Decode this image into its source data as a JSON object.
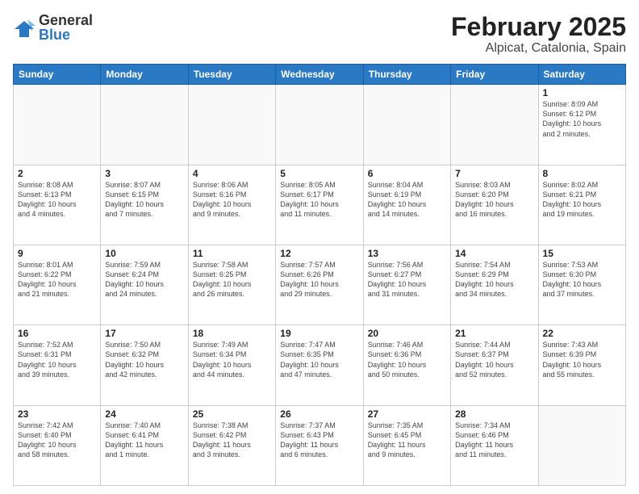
{
  "header": {
    "logo_general": "General",
    "logo_blue": "Blue",
    "title": "February 2025",
    "subtitle": "Alpicat, Catalonia, Spain"
  },
  "weekdays": [
    "Sunday",
    "Monday",
    "Tuesday",
    "Wednesday",
    "Thursday",
    "Friday",
    "Saturday"
  ],
  "weeks": [
    [
      {
        "day": "",
        "info": ""
      },
      {
        "day": "",
        "info": ""
      },
      {
        "day": "",
        "info": ""
      },
      {
        "day": "",
        "info": ""
      },
      {
        "day": "",
        "info": ""
      },
      {
        "day": "",
        "info": ""
      },
      {
        "day": "1",
        "info": "Sunrise: 8:09 AM\nSunset: 6:12 PM\nDaylight: 10 hours\nand 2 minutes."
      }
    ],
    [
      {
        "day": "2",
        "info": "Sunrise: 8:08 AM\nSunset: 6:13 PM\nDaylight: 10 hours\nand 4 minutes."
      },
      {
        "day": "3",
        "info": "Sunrise: 8:07 AM\nSunset: 6:15 PM\nDaylight: 10 hours\nand 7 minutes."
      },
      {
        "day": "4",
        "info": "Sunrise: 8:06 AM\nSunset: 6:16 PM\nDaylight: 10 hours\nand 9 minutes."
      },
      {
        "day": "5",
        "info": "Sunrise: 8:05 AM\nSunset: 6:17 PM\nDaylight: 10 hours\nand 11 minutes."
      },
      {
        "day": "6",
        "info": "Sunrise: 8:04 AM\nSunset: 6:19 PM\nDaylight: 10 hours\nand 14 minutes."
      },
      {
        "day": "7",
        "info": "Sunrise: 8:03 AM\nSunset: 6:20 PM\nDaylight: 10 hours\nand 16 minutes."
      },
      {
        "day": "8",
        "info": "Sunrise: 8:02 AM\nSunset: 6:21 PM\nDaylight: 10 hours\nand 19 minutes."
      }
    ],
    [
      {
        "day": "9",
        "info": "Sunrise: 8:01 AM\nSunset: 6:22 PM\nDaylight: 10 hours\nand 21 minutes."
      },
      {
        "day": "10",
        "info": "Sunrise: 7:59 AM\nSunset: 6:24 PM\nDaylight: 10 hours\nand 24 minutes."
      },
      {
        "day": "11",
        "info": "Sunrise: 7:58 AM\nSunset: 6:25 PM\nDaylight: 10 hours\nand 26 minutes."
      },
      {
        "day": "12",
        "info": "Sunrise: 7:57 AM\nSunset: 6:26 PM\nDaylight: 10 hours\nand 29 minutes."
      },
      {
        "day": "13",
        "info": "Sunrise: 7:56 AM\nSunset: 6:27 PM\nDaylight: 10 hours\nand 31 minutes."
      },
      {
        "day": "14",
        "info": "Sunrise: 7:54 AM\nSunset: 6:29 PM\nDaylight: 10 hours\nand 34 minutes."
      },
      {
        "day": "15",
        "info": "Sunrise: 7:53 AM\nSunset: 6:30 PM\nDaylight: 10 hours\nand 37 minutes."
      }
    ],
    [
      {
        "day": "16",
        "info": "Sunrise: 7:52 AM\nSunset: 6:31 PM\nDaylight: 10 hours\nand 39 minutes."
      },
      {
        "day": "17",
        "info": "Sunrise: 7:50 AM\nSunset: 6:32 PM\nDaylight: 10 hours\nand 42 minutes."
      },
      {
        "day": "18",
        "info": "Sunrise: 7:49 AM\nSunset: 6:34 PM\nDaylight: 10 hours\nand 44 minutes."
      },
      {
        "day": "19",
        "info": "Sunrise: 7:47 AM\nSunset: 6:35 PM\nDaylight: 10 hours\nand 47 minutes."
      },
      {
        "day": "20",
        "info": "Sunrise: 7:46 AM\nSunset: 6:36 PM\nDaylight: 10 hours\nand 50 minutes."
      },
      {
        "day": "21",
        "info": "Sunrise: 7:44 AM\nSunset: 6:37 PM\nDaylight: 10 hours\nand 52 minutes."
      },
      {
        "day": "22",
        "info": "Sunrise: 7:43 AM\nSunset: 6:39 PM\nDaylight: 10 hours\nand 55 minutes."
      }
    ],
    [
      {
        "day": "23",
        "info": "Sunrise: 7:42 AM\nSunset: 6:40 PM\nDaylight: 10 hours\nand 58 minutes."
      },
      {
        "day": "24",
        "info": "Sunrise: 7:40 AM\nSunset: 6:41 PM\nDaylight: 11 hours\nand 1 minute."
      },
      {
        "day": "25",
        "info": "Sunrise: 7:38 AM\nSunset: 6:42 PM\nDaylight: 11 hours\nand 3 minutes."
      },
      {
        "day": "26",
        "info": "Sunrise: 7:37 AM\nSunset: 6:43 PM\nDaylight: 11 hours\nand 6 minutes."
      },
      {
        "day": "27",
        "info": "Sunrise: 7:35 AM\nSunset: 6:45 PM\nDaylight: 11 hours\nand 9 minutes."
      },
      {
        "day": "28",
        "info": "Sunrise: 7:34 AM\nSunset: 6:46 PM\nDaylight: 11 hours\nand 11 minutes."
      },
      {
        "day": "",
        "info": ""
      }
    ]
  ]
}
